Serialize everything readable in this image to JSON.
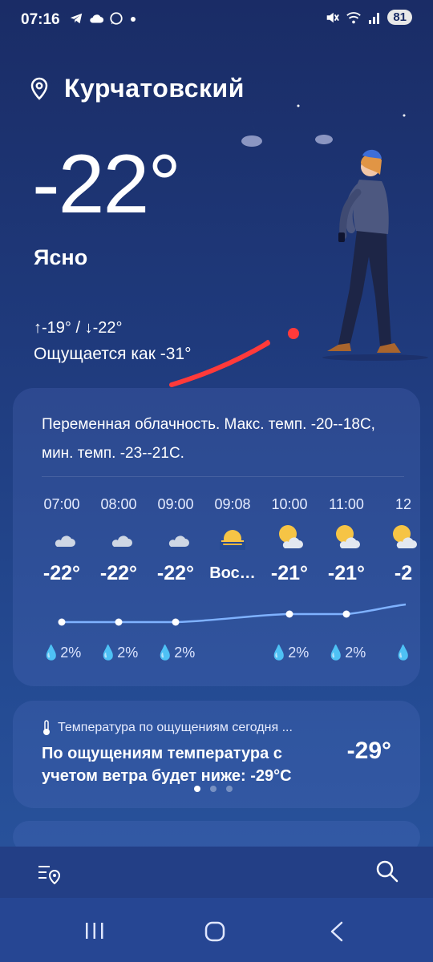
{
  "status_bar": {
    "time": "07:16",
    "battery": "81",
    "icons": [
      "telegram-icon",
      "cloud-icon",
      "whatsapp-icon",
      "dot-icon",
      "mute-icon",
      "wifi-icon",
      "signal-icon"
    ]
  },
  "location": {
    "city": "Курчатовский",
    "icon": "location-pin-icon"
  },
  "current": {
    "temp": "-22°",
    "condition": "Ясно",
    "minmax": "↑-19° / ↓-22°",
    "feels_like": "Ощущается как -31°"
  },
  "forecast_card": {
    "summary": "Переменная облачность. Макс. темп. -20--18C, мин. темп. -23--21C.",
    "hours": [
      {
        "time": "07:00",
        "icon": "moon-cloud-icon",
        "temp": "-22°",
        "precip": "2%"
      },
      {
        "time": "08:00",
        "icon": "moon-cloud-icon",
        "temp": "-22°",
        "precip": "2%"
      },
      {
        "time": "09:00",
        "icon": "moon-cloud-icon",
        "temp": "-22°",
        "precip": "2%"
      },
      {
        "time": "09:08",
        "icon": "sunrise-icon",
        "temp": "Вос…",
        "precip": ""
      },
      {
        "time": "10:00",
        "icon": "sun-cloud-icon",
        "temp": "-21°",
        "precip": "2%"
      },
      {
        "time": "11:00",
        "icon": "sun-cloud-icon",
        "temp": "-21°",
        "precip": "2%"
      },
      {
        "time": "12",
        "icon": "sun-cloud-icon",
        "temp": "-2",
        "precip": ""
      }
    ]
  },
  "feels_card": {
    "title": "Температура по ощущениям сегодня ...",
    "body": "По ощущениям температура с учетом ветра будет ниже: -29°C",
    "temp": "-29°",
    "page_count": 3,
    "active_page": 1
  },
  "bottom_bar": {
    "left_icon": "manage-locations-icon",
    "right_icon": "search-icon"
  },
  "nav_bar": {
    "buttons": [
      "recent-apps-icon",
      "home-icon",
      "back-icon"
    ]
  }
}
